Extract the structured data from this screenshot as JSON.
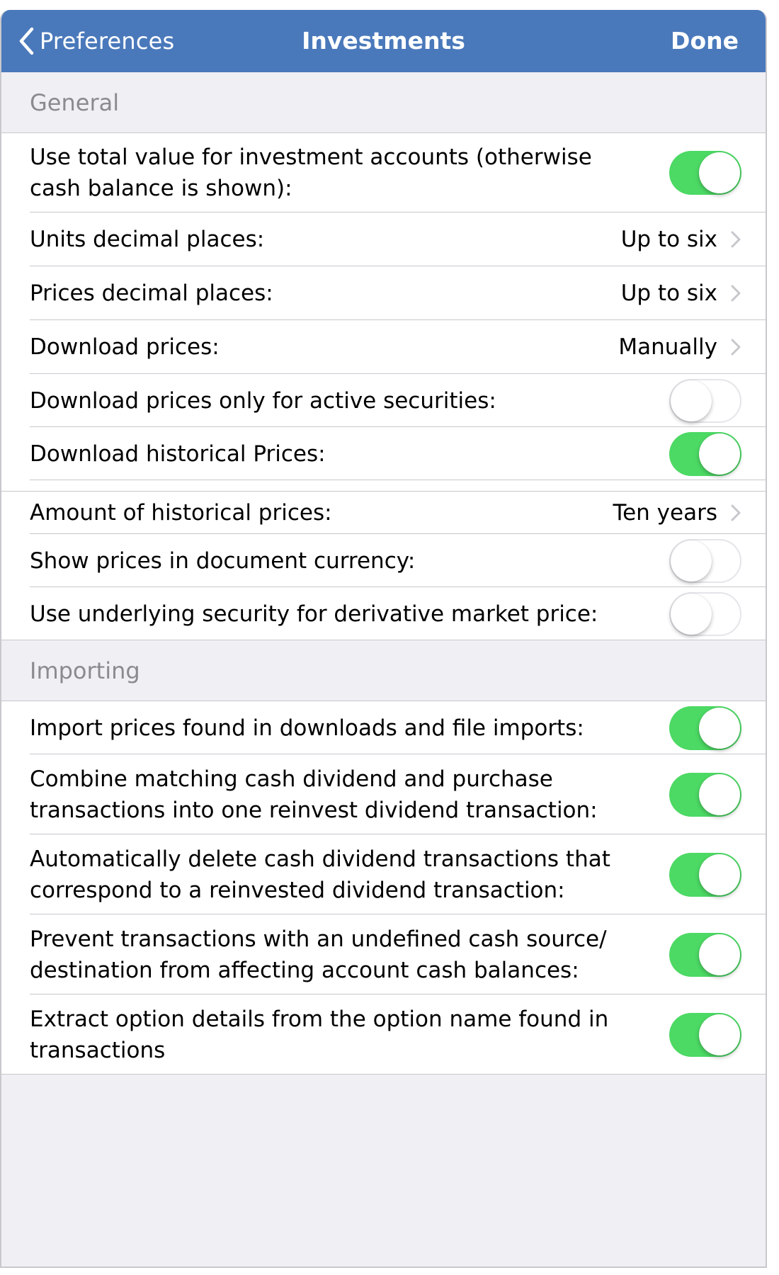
{
  "navbar": {
    "back_label": "Preferences",
    "title": "Investments",
    "done_label": "Done",
    "background_color": "#4a79bb"
  },
  "colors": {
    "toggle_on": "#4cd964",
    "section_background": "#efeff4",
    "section_header_text": "#8a8a8f"
  },
  "sections": {
    "general": {
      "header": "General",
      "rows": {
        "total_value": {
          "label": "Use total value for investment accounts (otherwise cash balance is shown):",
          "toggle": true
        },
        "units_decimal": {
          "label": "Units decimal places:",
          "value": "Up to six"
        },
        "prices_decimal": {
          "label": "Prices decimal places:",
          "value": "Up to six"
        },
        "download_prices": {
          "label": "Download prices:",
          "value": "Manually"
        },
        "active_only": {
          "label": "Download prices only for active securities:",
          "toggle": false
        },
        "historical": {
          "label": "Download historical Prices:",
          "toggle": true
        },
        "historical_amount": {
          "label": "Amount of historical prices:",
          "value": "Ten years"
        },
        "doc_currency": {
          "label": "Show prices in document currency:",
          "toggle": false
        },
        "underlying": {
          "label": "Use underlying security for derivative market price:",
          "toggle": false
        }
      }
    },
    "importing": {
      "header": "Importing",
      "rows": {
        "import_prices": {
          "label": "Import prices found in downloads and file imports:",
          "toggle": true
        },
        "combine_dividend": {
          "label": "Combine matching cash dividend and purchase transactions into one reinvest dividend transaction:",
          "toggle": true
        },
        "auto_delete": {
          "label": "Automatically delete cash dividend transactions that correspond to a reinvested dividend transaction:",
          "toggle": true
        },
        "prevent_undefined": {
          "label": "Prevent transactions with an undefined cash source/ destination from affecting account cash balances:",
          "toggle": true
        },
        "extract_option": {
          "label": "Extract option details from the option name found in transactions",
          "toggle": true
        }
      }
    }
  }
}
